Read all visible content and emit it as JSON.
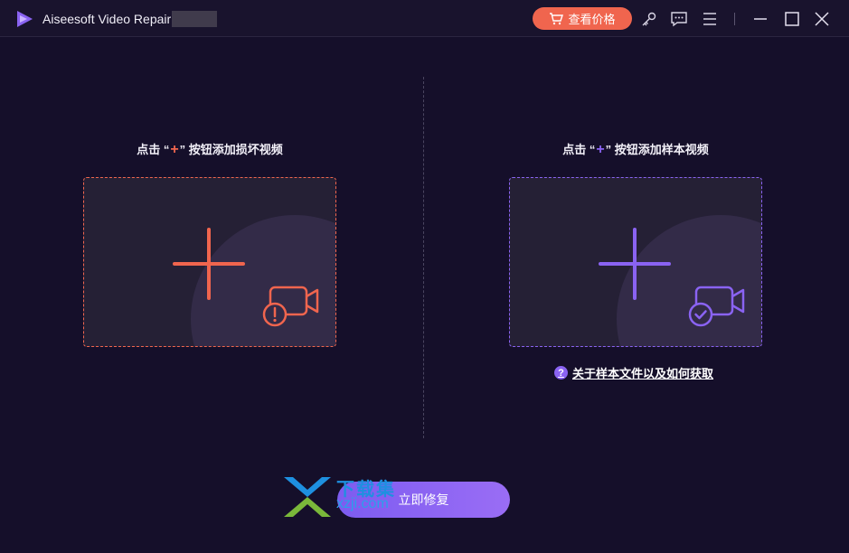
{
  "titlebar": {
    "app_title": "Aiseesoft Video Repair",
    "price_button": "查看价格",
    "icons": [
      "key-icon",
      "feedback-icon",
      "menu-icon",
      "minimize-icon",
      "maximize-icon",
      "close-icon"
    ]
  },
  "left_panel": {
    "label_prefix": "点击 “",
    "label_plus": "+",
    "label_suffix": "” 按钮添加损坏视频",
    "accent_color": "#f0654e"
  },
  "right_panel": {
    "label_prefix": "点击 “",
    "label_plus": "+",
    "label_suffix": "” 按钮添加样本视频",
    "accent_color": "#8a63f2",
    "help_link": "关于样本文件以及如何获取",
    "help_icon_glyph": "?"
  },
  "actions": {
    "repair_button": "立即修复"
  },
  "watermark": {
    "line1": "下载集",
    "line2": "xzji.com"
  },
  "colors": {
    "background": "#150f2a",
    "titlebar": "#19132d",
    "red_accent": "#f0654e",
    "purple_accent": "#8a63f2"
  }
}
